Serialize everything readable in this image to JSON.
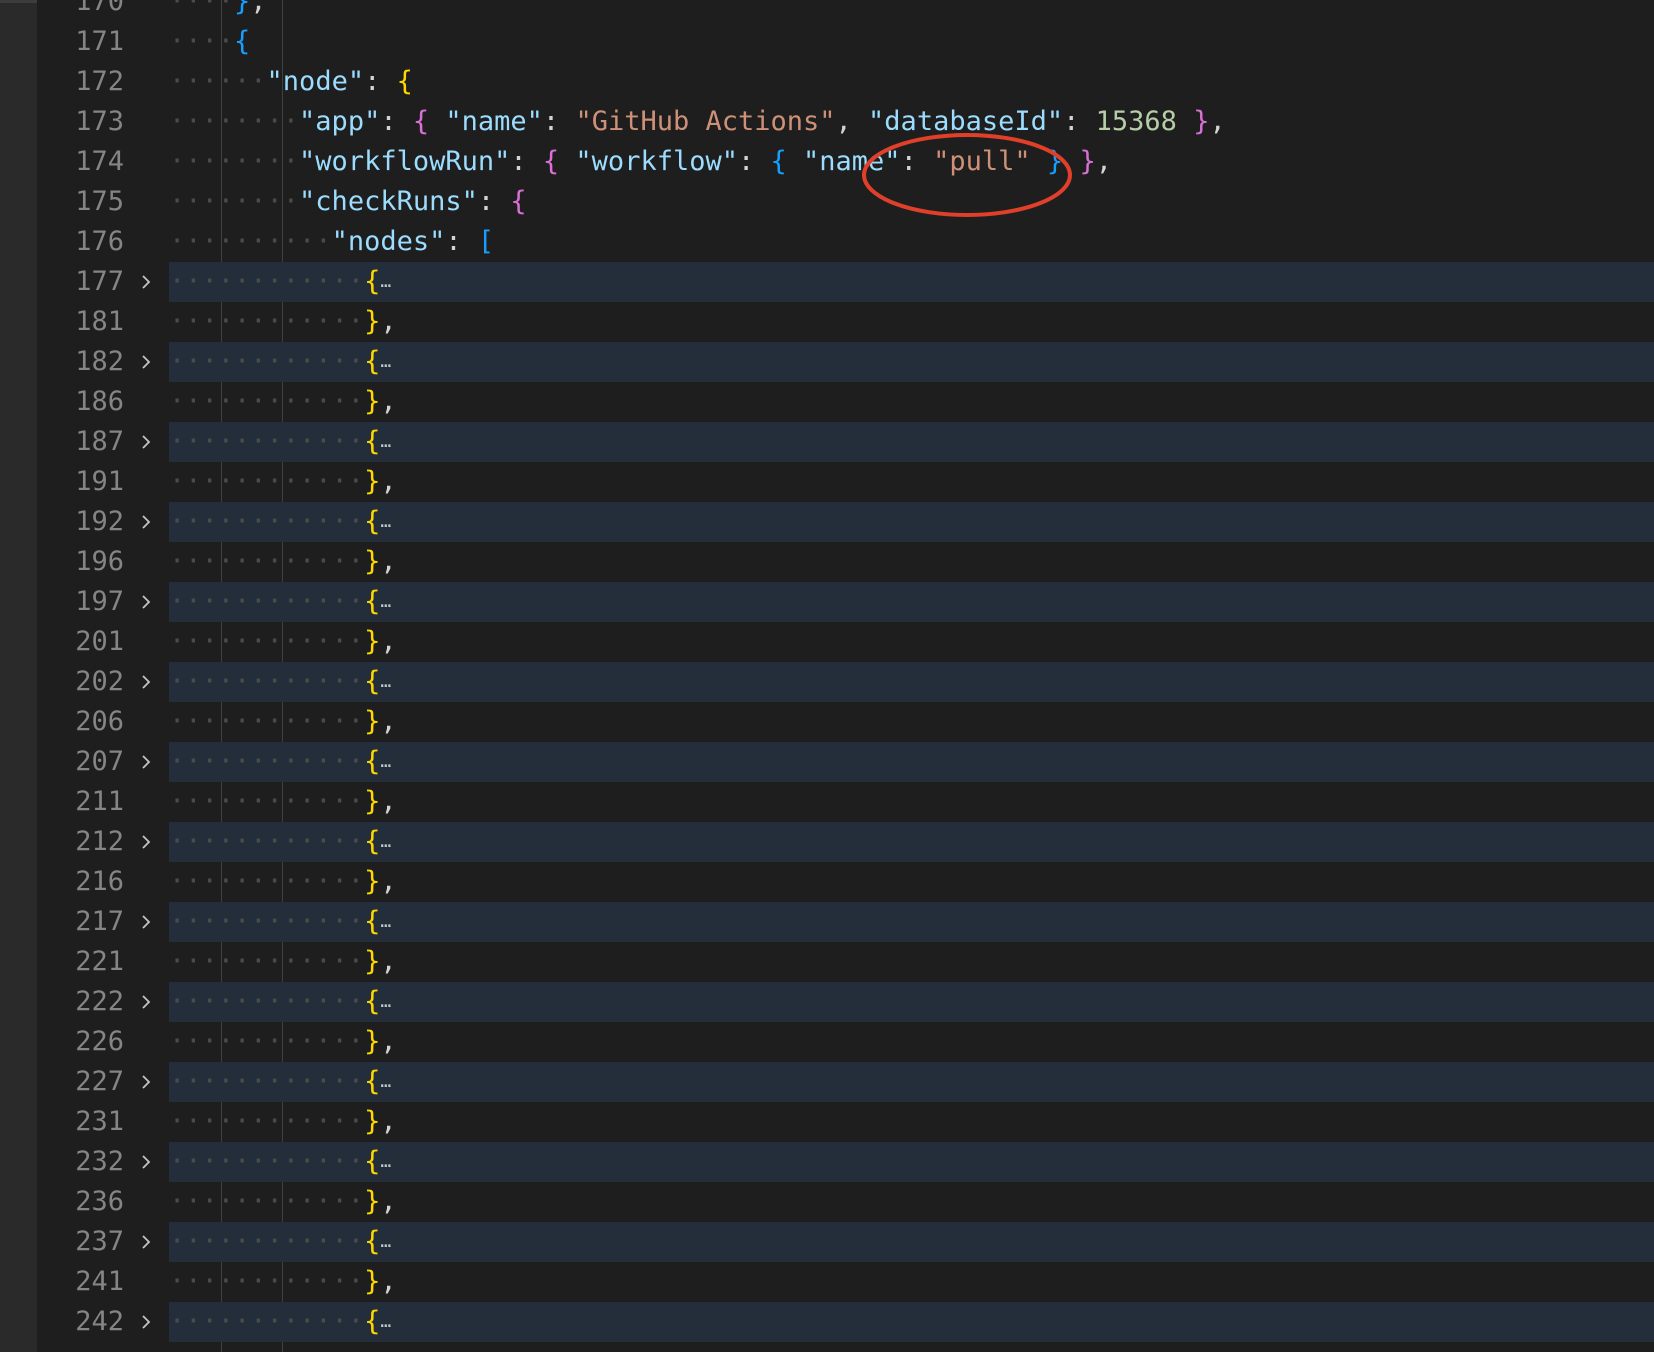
{
  "editor": {
    "language": "json",
    "lines": [
      {
        "n": "170",
        "indent": 4,
        "tokens": [
          {
            "t": "}",
            "c": "b3"
          },
          {
            "t": ",",
            "c": "punc"
          }
        ]
      },
      {
        "n": "171",
        "indent": 4,
        "tokens": [
          {
            "t": "{",
            "c": "b3"
          }
        ]
      },
      {
        "n": "172",
        "indent": 6,
        "tokens": [
          {
            "t": "\"node\"",
            "c": "key"
          },
          {
            "t": ": ",
            "c": "punc"
          },
          {
            "t": "{",
            "c": "b1"
          }
        ]
      },
      {
        "n": "173",
        "indent": 8,
        "tokens": [
          {
            "t": "\"app\"",
            "c": "key"
          },
          {
            "t": ": ",
            "c": "punc"
          },
          {
            "t": "{",
            "c": "b2"
          },
          {
            "t": " ",
            "c": "punc"
          },
          {
            "t": "\"name\"",
            "c": "key"
          },
          {
            "t": ": ",
            "c": "punc"
          },
          {
            "t": "\"GitHub Actions\"",
            "c": "str"
          },
          {
            "t": ", ",
            "c": "punc"
          },
          {
            "t": "\"databaseId\"",
            "c": "key"
          },
          {
            "t": ": ",
            "c": "punc"
          },
          {
            "t": "15368",
            "c": "num"
          },
          {
            "t": " ",
            "c": "punc"
          },
          {
            "t": "}",
            "c": "b2"
          },
          {
            "t": ",",
            "c": "punc"
          }
        ]
      },
      {
        "n": "174",
        "indent": 8,
        "tokens": [
          {
            "t": "\"workflowRun\"",
            "c": "key"
          },
          {
            "t": ": ",
            "c": "punc"
          },
          {
            "t": "{",
            "c": "b2"
          },
          {
            "t": " ",
            "c": "punc"
          },
          {
            "t": "\"workflow\"",
            "c": "key"
          },
          {
            "t": ": ",
            "c": "punc"
          },
          {
            "t": "{",
            "c": "b3"
          },
          {
            "t": " ",
            "c": "punc"
          },
          {
            "t": "\"name\"",
            "c": "key"
          },
          {
            "t": ": ",
            "c": "punc"
          },
          {
            "t": "\"pull\"",
            "c": "str"
          },
          {
            "t": " ",
            "c": "punc"
          },
          {
            "t": "}",
            "c": "b3"
          },
          {
            "t": " ",
            "c": "punc"
          },
          {
            "t": "}",
            "c": "b2"
          },
          {
            "t": ",",
            "c": "punc"
          }
        ]
      },
      {
        "n": "175",
        "indent": 8,
        "tokens": [
          {
            "t": "\"checkRuns\"",
            "c": "key"
          },
          {
            "t": ": ",
            "c": "punc"
          },
          {
            "t": "{",
            "c": "b2"
          }
        ]
      },
      {
        "n": "176",
        "indent": 10,
        "tokens": [
          {
            "t": "\"nodes\"",
            "c": "key"
          },
          {
            "t": ": ",
            "c": "punc"
          },
          {
            "t": "[",
            "c": "b3"
          }
        ]
      },
      {
        "n": "177",
        "indent": 12,
        "folded": true,
        "tokens": [
          {
            "t": "{",
            "c": "b1"
          },
          {
            "t": "…",
            "c": "ellipsis"
          }
        ]
      },
      {
        "n": "181",
        "indent": 12,
        "tokens": [
          {
            "t": "}",
            "c": "b1"
          },
          {
            "t": ",",
            "c": "punc"
          }
        ]
      },
      {
        "n": "182",
        "indent": 12,
        "folded": true,
        "tokens": [
          {
            "t": "{",
            "c": "b1"
          },
          {
            "t": "…",
            "c": "ellipsis"
          }
        ]
      },
      {
        "n": "186",
        "indent": 12,
        "tokens": [
          {
            "t": "}",
            "c": "b1"
          },
          {
            "t": ",",
            "c": "punc"
          }
        ]
      },
      {
        "n": "187",
        "indent": 12,
        "folded": true,
        "tokens": [
          {
            "t": "{",
            "c": "b1"
          },
          {
            "t": "…",
            "c": "ellipsis"
          }
        ]
      },
      {
        "n": "191",
        "indent": 12,
        "tokens": [
          {
            "t": "}",
            "c": "b1"
          },
          {
            "t": ",",
            "c": "punc"
          }
        ]
      },
      {
        "n": "192",
        "indent": 12,
        "folded": true,
        "tokens": [
          {
            "t": "{",
            "c": "b1"
          },
          {
            "t": "…",
            "c": "ellipsis"
          }
        ]
      },
      {
        "n": "196",
        "indent": 12,
        "tokens": [
          {
            "t": "}",
            "c": "b1"
          },
          {
            "t": ",",
            "c": "punc"
          }
        ]
      },
      {
        "n": "197",
        "indent": 12,
        "folded": true,
        "tokens": [
          {
            "t": "{",
            "c": "b1"
          },
          {
            "t": "…",
            "c": "ellipsis"
          }
        ]
      },
      {
        "n": "201",
        "indent": 12,
        "tokens": [
          {
            "t": "}",
            "c": "b1"
          },
          {
            "t": ",",
            "c": "punc"
          }
        ]
      },
      {
        "n": "202",
        "indent": 12,
        "folded": true,
        "tokens": [
          {
            "t": "{",
            "c": "b1"
          },
          {
            "t": "…",
            "c": "ellipsis"
          }
        ]
      },
      {
        "n": "206",
        "indent": 12,
        "tokens": [
          {
            "t": "}",
            "c": "b1"
          },
          {
            "t": ",",
            "c": "punc"
          }
        ]
      },
      {
        "n": "207",
        "indent": 12,
        "folded": true,
        "tokens": [
          {
            "t": "{",
            "c": "b1"
          },
          {
            "t": "…",
            "c": "ellipsis"
          }
        ]
      },
      {
        "n": "211",
        "indent": 12,
        "tokens": [
          {
            "t": "}",
            "c": "b1"
          },
          {
            "t": ",",
            "c": "punc"
          }
        ]
      },
      {
        "n": "212",
        "indent": 12,
        "folded": true,
        "tokens": [
          {
            "t": "{",
            "c": "b1"
          },
          {
            "t": "…",
            "c": "ellipsis"
          }
        ]
      },
      {
        "n": "216",
        "indent": 12,
        "tokens": [
          {
            "t": "}",
            "c": "b1"
          },
          {
            "t": ",",
            "c": "punc"
          }
        ]
      },
      {
        "n": "217",
        "indent": 12,
        "folded": true,
        "tokens": [
          {
            "t": "{",
            "c": "b1"
          },
          {
            "t": "…",
            "c": "ellipsis"
          }
        ]
      },
      {
        "n": "221",
        "indent": 12,
        "tokens": [
          {
            "t": "}",
            "c": "b1"
          },
          {
            "t": ",",
            "c": "punc"
          }
        ]
      },
      {
        "n": "222",
        "indent": 12,
        "folded": true,
        "tokens": [
          {
            "t": "{",
            "c": "b1"
          },
          {
            "t": "…",
            "c": "ellipsis"
          }
        ]
      },
      {
        "n": "226",
        "indent": 12,
        "tokens": [
          {
            "t": "}",
            "c": "b1"
          },
          {
            "t": ",",
            "c": "punc"
          }
        ]
      },
      {
        "n": "227",
        "indent": 12,
        "folded": true,
        "tokens": [
          {
            "t": "{",
            "c": "b1"
          },
          {
            "t": "…",
            "c": "ellipsis"
          }
        ]
      },
      {
        "n": "231",
        "indent": 12,
        "tokens": [
          {
            "t": "}",
            "c": "b1"
          },
          {
            "t": ",",
            "c": "punc"
          }
        ]
      },
      {
        "n": "232",
        "indent": 12,
        "folded": true,
        "tokens": [
          {
            "t": "{",
            "c": "b1"
          },
          {
            "t": "…",
            "c": "ellipsis"
          }
        ]
      },
      {
        "n": "236",
        "indent": 12,
        "tokens": [
          {
            "t": "}",
            "c": "b1"
          },
          {
            "t": ",",
            "c": "punc"
          }
        ]
      },
      {
        "n": "237",
        "indent": 12,
        "folded": true,
        "tokens": [
          {
            "t": "{",
            "c": "b1"
          },
          {
            "t": "…",
            "c": "ellipsis"
          }
        ]
      },
      {
        "n": "241",
        "indent": 12,
        "tokens": [
          {
            "t": "}",
            "c": "b1"
          },
          {
            "t": ",",
            "c": "punc"
          }
        ]
      },
      {
        "n": "242",
        "indent": 12,
        "folded": true,
        "tokens": [
          {
            "t": "{",
            "c": "b1"
          },
          {
            "t": "…",
            "c": "ellipsis"
          }
        ]
      }
    ]
  },
  "colors": {
    "background": "#1e1e1e",
    "folded_line_bg": "#242e3a",
    "key": "#9cdcfe",
    "string": "#ce9178",
    "number": "#b5cea8",
    "bracket_level1": "#ffd700",
    "bracket_level2": "#da70d6",
    "bracket_level3": "#179fff",
    "annotation_circle": "#e0402a"
  },
  "icons": {
    "fold": "chevron-right-icon",
    "annotation": "red-circle-annotation"
  }
}
